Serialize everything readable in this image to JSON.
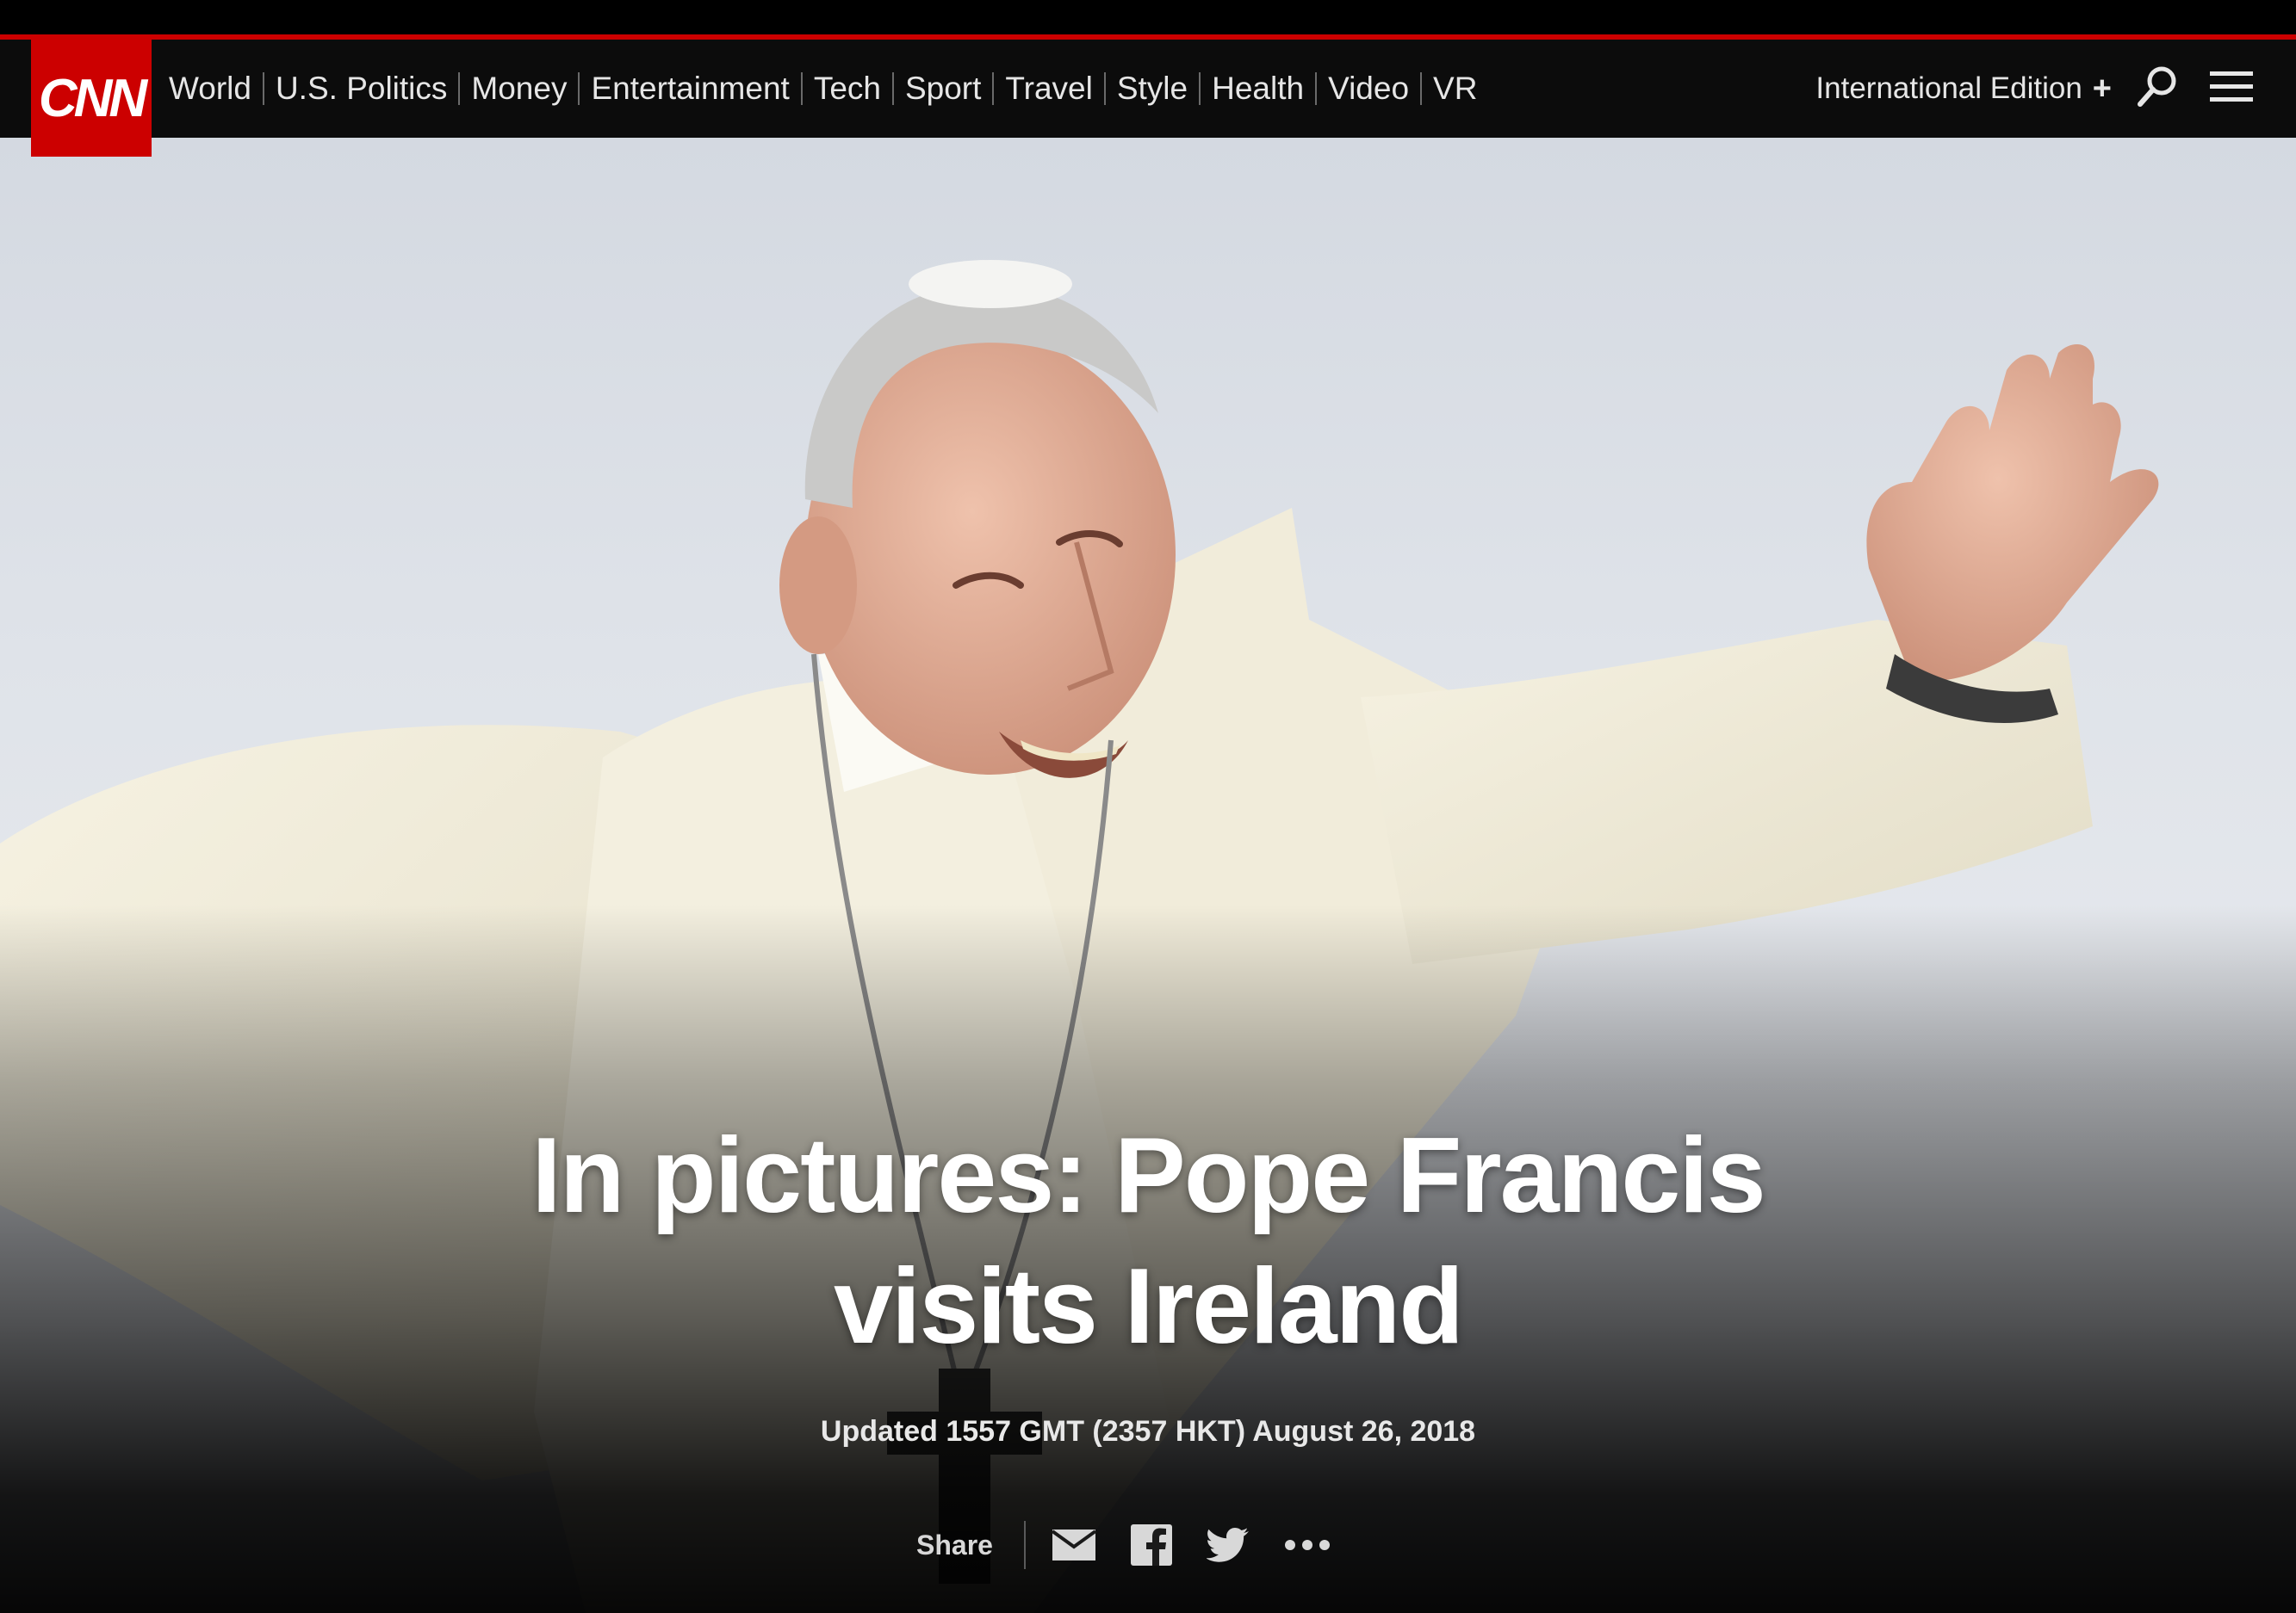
{
  "brand": {
    "logo_text": "CNN",
    "color": "#cc0000"
  },
  "nav": {
    "items": [
      {
        "label": "World"
      },
      {
        "label": "U.S. Politics"
      },
      {
        "label": "Money"
      },
      {
        "label": "Entertainment"
      },
      {
        "label": "Tech"
      },
      {
        "label": "Sport"
      },
      {
        "label": "Travel"
      },
      {
        "label": "Style"
      },
      {
        "label": "Health"
      },
      {
        "label": "Video"
      },
      {
        "label": "VR"
      }
    ],
    "edition_label": "International Edition",
    "edition_plus": "+",
    "search_icon": "search-icon",
    "menu_icon": "hamburger-menu-icon"
  },
  "article": {
    "headline_line1": "In pictures: Pope Francis",
    "headline_line2": "visits Ireland",
    "updated": "Updated 1557 GMT (2357 HKT) August 26, 2018",
    "hero_image": "pope-waving-photo"
  },
  "share": {
    "label": "Share",
    "icons": [
      "email-icon",
      "facebook-icon",
      "twitter-icon",
      "more-icon"
    ]
  }
}
